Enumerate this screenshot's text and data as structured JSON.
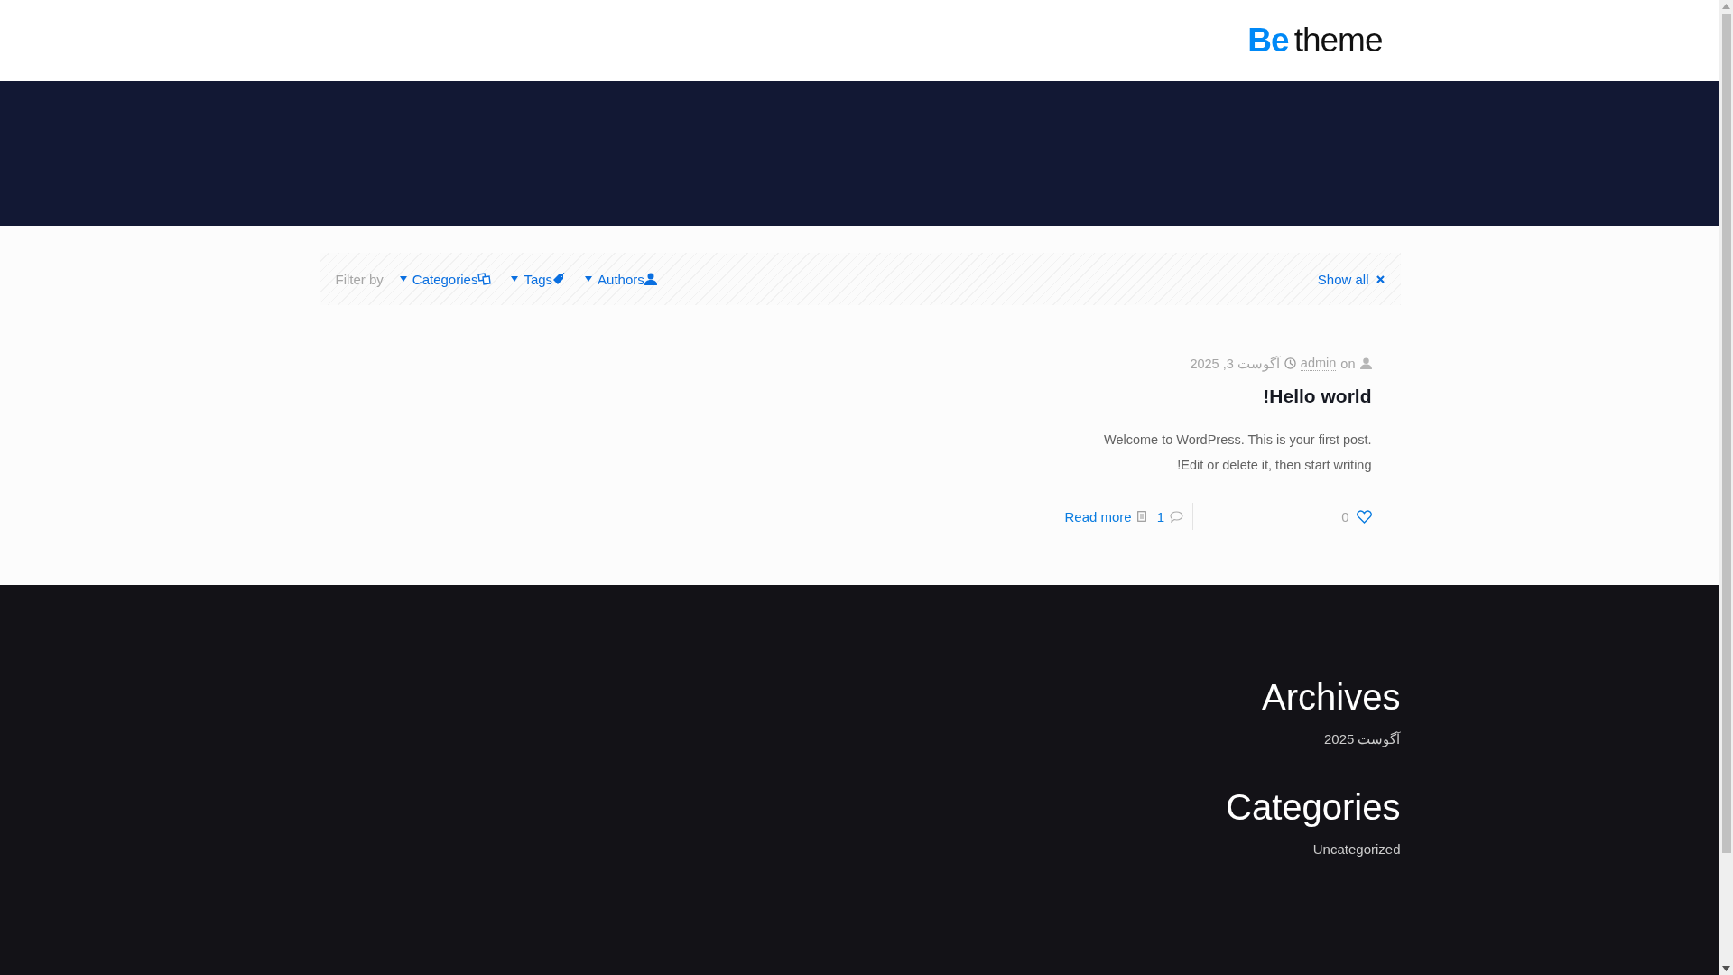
{
  "header": {
    "logo": {
      "bold": "Be",
      "light": "theme"
    }
  },
  "filter_bar": {
    "label": "Filter by",
    "filters": [
      {
        "label": "Categories",
        "kind": "categories"
      },
      {
        "label": "Tags",
        "kind": "tags"
      },
      {
        "label": "Authors",
        "kind": "authors"
      }
    ],
    "show_all": "Show all"
  },
  "post": {
    "on": "on",
    "author": "admin",
    "date": "آگوست 3, 2025",
    "title": "Hello world!",
    "excerpt": "Welcome to WordPress. This is your first post. Edit or delete it, then start writing!",
    "read_more": "Read more",
    "comments": "1",
    "likes": "0"
  },
  "footer": {
    "widgets": [
      {
        "title": "Archives",
        "links": [
          "آگوست 2025"
        ]
      },
      {
        "title": "Categories",
        "links": [
          "Uncategorized"
        ]
      }
    ]
  }
}
